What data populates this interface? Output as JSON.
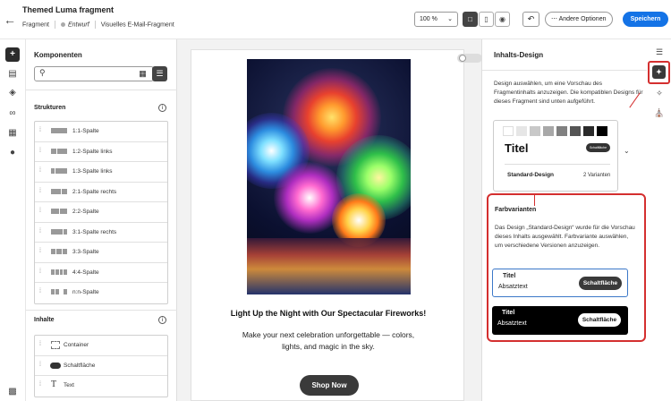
{
  "header": {
    "title": "Themed Luma fragment",
    "type": "Fragment",
    "status": "Entwurf",
    "subtitle": "Visuelles E-Mail-Fragment",
    "zoom": "100 %",
    "more_label": "Andere Optionen",
    "save_label": "Speichern"
  },
  "components": {
    "title": "Komponenten",
    "search_placeholder": "",
    "structures_title": "Strukturen",
    "structures": [
      "1:1-Spalte",
      "1:2-Spalte links",
      "1:3-Spalte links",
      "2:1-Spalte rechts",
      "2:2-Spalte",
      "3:1-Spalte rechts",
      "3:3-Spalte",
      "4:4-Spalte",
      "n:n-Spalte"
    ],
    "contents_title": "Inhalte",
    "contents": [
      "Container",
      "Schaltfläche",
      "Text"
    ]
  },
  "email": {
    "headline": "Light Up the Night with Our Spectacular Fireworks!",
    "body": "Make your next celebration unforgettable — colors, lights, and magic in the sky.",
    "cta": "Shop Now"
  },
  "design_panel": {
    "title": "Inhalts-Design",
    "description": "Design auswählen, um eine Vorschau des Fragmentinhalts anzuzeigen. Die kompatiblen Designs für dieses Fragment sind unten aufgeführt.",
    "card_title": "Titel",
    "card_button": "Schaltfläche",
    "design_name": "Standard-Design",
    "variants": "2 Varianten",
    "swatches": [
      "#ffffff",
      "#e6e6e6",
      "#c8c8c8",
      "#a8a8a8",
      "#808080",
      "#555555",
      "#2a2a2a",
      "#000000"
    ],
    "farb_title": "Farbvarianten",
    "farb_desc": "Das Design „Standard-Design“ wurde für die Vorschau dieses Inhalts ausgewählt. Farbvariante auswählen, um verschiedene Versionen anzuzeigen.",
    "variant_cards": [
      {
        "title": "Titel",
        "text": "Absatztext",
        "button": "Schaltfläche"
      },
      {
        "title": "Titel",
        "text": "Absatztext",
        "button": "Schaltfläche"
      }
    ]
  },
  "colors": {
    "accent": "#1473e6",
    "highlight": "#d42f2f"
  }
}
